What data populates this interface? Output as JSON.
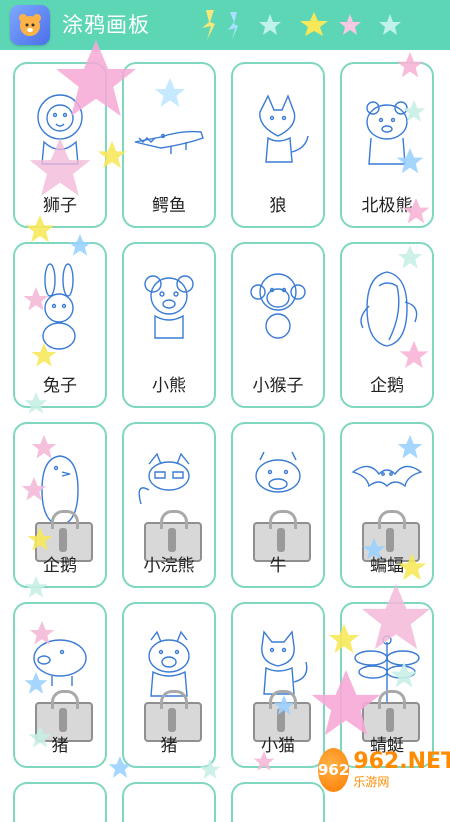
{
  "app": {
    "title": "涂鸦画板"
  },
  "animals": [
    {
      "label": "狮子",
      "icon": "lion-drawing-icon",
      "locked": false
    },
    {
      "label": "鳄鱼",
      "icon": "crocodile-drawing-icon",
      "locked": false
    },
    {
      "label": "狼",
      "icon": "wolf-drawing-icon",
      "locked": false
    },
    {
      "label": "北极熊",
      "icon": "polar-bear-drawing-icon",
      "locked": false
    },
    {
      "label": "兔子",
      "icon": "rabbit-drawing-icon",
      "locked": false
    },
    {
      "label": "小熊",
      "icon": "bear-drawing-icon",
      "locked": false
    },
    {
      "label": "小猴子",
      "icon": "monkey-drawing-icon",
      "locked": false
    },
    {
      "label": "企鹅",
      "icon": "penguin-drawing-icon",
      "locked": false
    },
    {
      "label": "企鹅",
      "icon": "penguin-drawing-icon",
      "locked": true
    },
    {
      "label": "小浣熊",
      "icon": "raccoon-drawing-icon",
      "locked": true
    },
    {
      "label": "牛",
      "icon": "cow-drawing-icon",
      "locked": true
    },
    {
      "label": "蝙蝠",
      "icon": "bat-drawing-icon",
      "locked": true
    },
    {
      "label": "猪",
      "icon": "pig-drawing-icon",
      "locked": true
    },
    {
      "label": "猪",
      "icon": "pig-drawing-icon",
      "locked": true
    },
    {
      "label": "小猫",
      "icon": "cat-drawing-icon",
      "locked": true
    },
    {
      "label": "蜻蜓",
      "icon": "dragonfly-drawing-icon",
      "locked": true
    }
  ],
  "watermark": {
    "brand": "962.NET",
    "site": "乐游网"
  },
  "colors": {
    "topbar": "#5dd6b6",
    "card_border": "#7fd7c0",
    "line_art": "#3a7bd5"
  }
}
